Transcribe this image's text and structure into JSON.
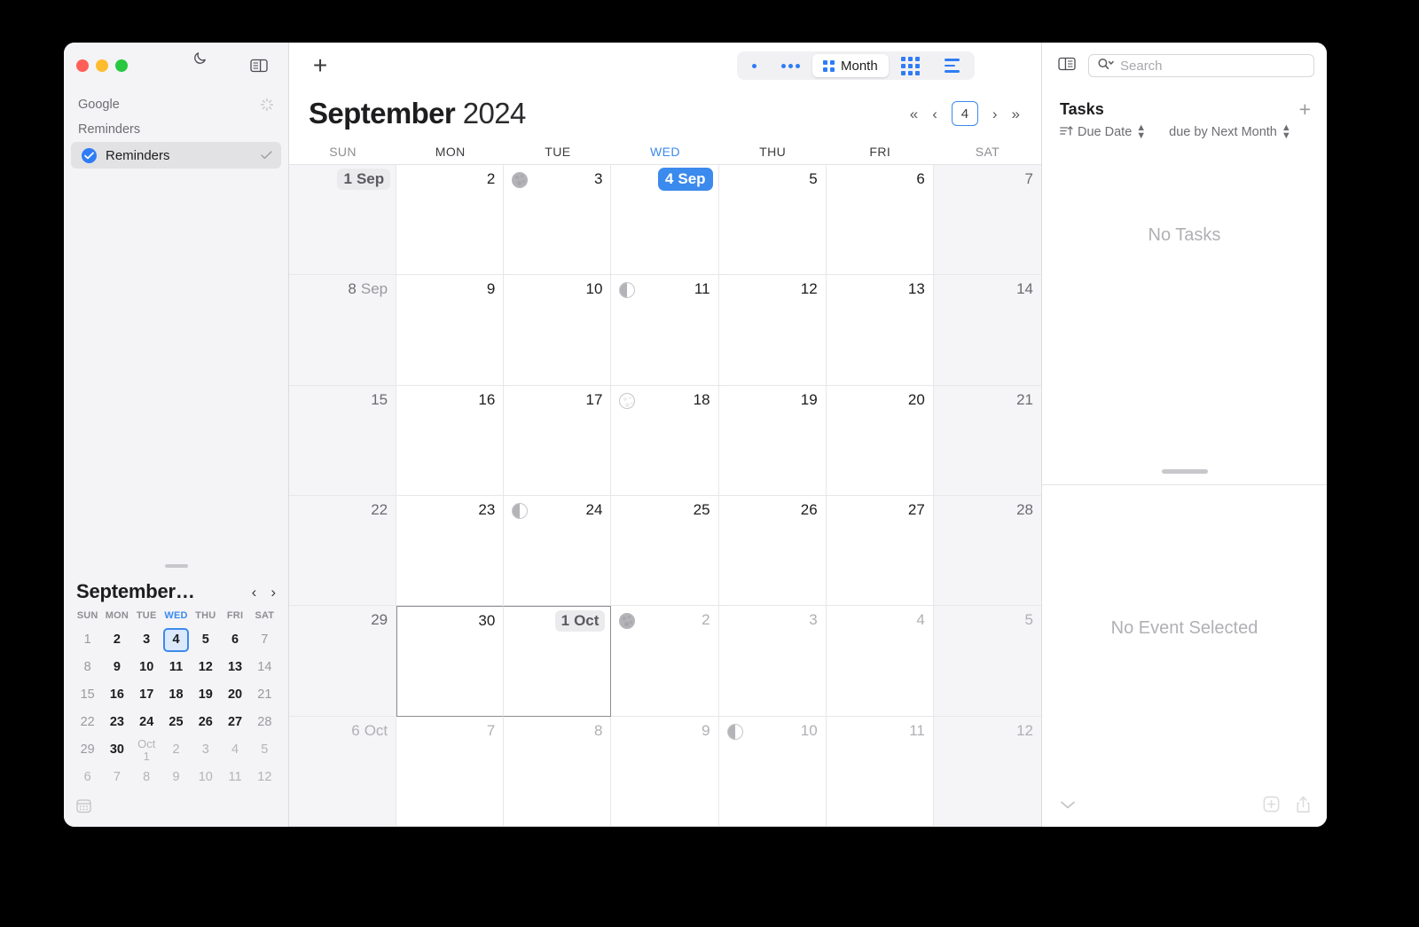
{
  "window": {
    "traffic_lights": [
      "close",
      "minimize",
      "zoom"
    ],
    "accent_blue": "#3b8aed",
    "today_blue": "#2f7cf6"
  },
  "sidebar": {
    "toolbar": {
      "dark_mode_icon": "moon-icon",
      "toggle_sidebar_icon": "sidebar-panel-icon"
    },
    "sections": [
      {
        "label": "Google",
        "status_icon": "sync-spinner-icon"
      },
      {
        "label": "Reminders"
      }
    ],
    "items": [
      {
        "label": "Reminders",
        "checked": true,
        "selected": true,
        "trailing_icon": "checkmark-icon"
      }
    ],
    "mini_calendar": {
      "title": "September…",
      "prev_label": "‹",
      "next_label": "›",
      "dow": [
        "SUN",
        "MON",
        "TUE",
        "WED",
        "THU",
        "FRI",
        "SAT"
      ],
      "highlight_dow": "WED",
      "selected_day": "4",
      "weeks": [
        [
          {
            "t": "1",
            "k": "weekend"
          },
          {
            "t": "2",
            "k": "wd"
          },
          {
            "t": "3",
            "k": "wd"
          },
          {
            "t": "4",
            "k": "sel"
          },
          {
            "t": "5",
            "k": "wd"
          },
          {
            "t": "6",
            "k": "wd"
          },
          {
            "t": "7",
            "k": "weekend"
          }
        ],
        [
          {
            "t": "8",
            "k": "weekend"
          },
          {
            "t": "9",
            "k": "wd"
          },
          {
            "t": "10",
            "k": "wd"
          },
          {
            "t": "11",
            "k": "wd"
          },
          {
            "t": "12",
            "k": "wd"
          },
          {
            "t": "13",
            "k": "wd"
          },
          {
            "t": "14",
            "k": "weekend"
          }
        ],
        [
          {
            "t": "15",
            "k": "weekend"
          },
          {
            "t": "16",
            "k": "wd"
          },
          {
            "t": "17",
            "k": "wd"
          },
          {
            "t": "18",
            "k": "wd"
          },
          {
            "t": "19",
            "k": "wd"
          },
          {
            "t": "20",
            "k": "wd"
          },
          {
            "t": "21",
            "k": "weekend"
          }
        ],
        [
          {
            "t": "22",
            "k": "weekend"
          },
          {
            "t": "23",
            "k": "wd"
          },
          {
            "t": "24",
            "k": "wd"
          },
          {
            "t": "25",
            "k": "wd"
          },
          {
            "t": "26",
            "k": "wd"
          },
          {
            "t": "27",
            "k": "wd"
          },
          {
            "t": "28",
            "k": "weekend"
          }
        ],
        [
          {
            "t": "29",
            "k": "weekend"
          },
          {
            "t": "30",
            "k": "wd"
          },
          {
            "t": "Oct 1",
            "k": "mon1"
          },
          {
            "t": "2",
            "k": "dim"
          },
          {
            "t": "3",
            "k": "dim"
          },
          {
            "t": "4",
            "k": "dim"
          },
          {
            "t": "5",
            "k": "dim"
          }
        ],
        [
          {
            "t": "6",
            "k": "dim"
          },
          {
            "t": "7",
            "k": "dim"
          },
          {
            "t": "8",
            "k": "dim"
          },
          {
            "t": "9",
            "k": "dim"
          },
          {
            "t": "10",
            "k": "dim"
          },
          {
            "t": "11",
            "k": "dim"
          },
          {
            "t": "12",
            "k": "dim"
          }
        ]
      ],
      "footer_icon": "mini-calendar-icon"
    }
  },
  "center": {
    "add_button": "+",
    "view_switcher": {
      "options": [
        {
          "name": "day-view",
          "icon": "single-dot-icon",
          "label": ""
        },
        {
          "name": "week-view",
          "icon": "three-dots-icon",
          "label": ""
        },
        {
          "name": "month-view",
          "icon": "grid-2x2-icon",
          "label": "Month",
          "active": true
        },
        {
          "name": "year-view",
          "icon": "grid-3x3-icon",
          "label": ""
        },
        {
          "name": "list-view",
          "icon": "list-lines-icon",
          "label": ""
        }
      ]
    },
    "title_month": "September",
    "title_year": "2024",
    "nav": {
      "first": "«",
      "prev": "‹",
      "today": "4",
      "next": "›",
      "last": "»"
    },
    "dow": [
      {
        "label": "SUN",
        "kind": "weekend"
      },
      {
        "label": "MON",
        "kind": "weekday"
      },
      {
        "label": "TUE",
        "kind": "weekday"
      },
      {
        "label": "WED",
        "kind": "highlight"
      },
      {
        "label": "THU",
        "kind": "weekday"
      },
      {
        "label": "FRI",
        "kind": "weekday"
      },
      {
        "label": "SAT",
        "kind": "weekend"
      }
    ],
    "weeks": [
      [
        {
          "num": "1",
          "mon": "Sep",
          "style": "pill",
          "weekend": true
        },
        {
          "num": "2"
        },
        {
          "num": "3",
          "moon": "new"
        },
        {
          "num": "4",
          "mon": "Sep",
          "style": "today"
        },
        {
          "num": "5"
        },
        {
          "num": "6"
        },
        {
          "num": "7",
          "weekend": true
        }
      ],
      [
        {
          "num": "8",
          "mon": "Sep",
          "weekend": true
        },
        {
          "num": "9"
        },
        {
          "num": "10"
        },
        {
          "num": "11",
          "moon": "last-q"
        },
        {
          "num": "12"
        },
        {
          "num": "13"
        },
        {
          "num": "14",
          "weekend": true
        }
      ],
      [
        {
          "num": "15",
          "weekend": true
        },
        {
          "num": "16"
        },
        {
          "num": "17"
        },
        {
          "num": "18",
          "moon": "full"
        },
        {
          "num": "19"
        },
        {
          "num": "20"
        },
        {
          "num": "21",
          "weekend": true
        }
      ],
      [
        {
          "num": "22",
          "weekend": true
        },
        {
          "num": "23"
        },
        {
          "num": "24",
          "moon": "last-q"
        },
        {
          "num": "25"
        },
        {
          "num": "26"
        },
        {
          "num": "27"
        },
        {
          "num": "28",
          "weekend": true
        }
      ],
      [
        {
          "num": "29",
          "weekend": true
        },
        {
          "num": "30",
          "box": "left-top-bottom"
        },
        {
          "num": "1",
          "mon": "Oct",
          "style": "pill",
          "box": "top-bottom-right"
        },
        {
          "num": "2",
          "dim": true,
          "moon": "new"
        },
        {
          "num": "3",
          "dim": true
        },
        {
          "num": "4",
          "dim": true
        },
        {
          "num": "5",
          "dim": true,
          "weekend": true
        }
      ],
      [
        {
          "num": "6",
          "mon": "Oct",
          "dim": true,
          "weekend": true
        },
        {
          "num": "7",
          "dim": true
        },
        {
          "num": "8",
          "dim": true
        },
        {
          "num": "9",
          "dim": true
        },
        {
          "num": "10",
          "dim": true,
          "moon": "last-q"
        },
        {
          "num": "11",
          "dim": true
        },
        {
          "num": "12",
          "dim": true,
          "weekend": true
        }
      ]
    ]
  },
  "inspector": {
    "toggle_icon": "inspector-panel-icon",
    "search": {
      "placeholder": "Search",
      "value": "",
      "icon": "search-magnifier-chevron-icon"
    },
    "tasks": {
      "title": "Tasks",
      "add_label": "+",
      "sort_label": "Due Date",
      "sort_icon": "sort-ascending-icon",
      "filter_label": "due by Next Month",
      "empty_message": "No Tasks"
    },
    "event": {
      "empty_message": "No Event Selected"
    },
    "footer": {
      "collapse_icon": "chevron-down-icon",
      "add_to_icon": "add-to-box-icon",
      "share_icon": "share-icon"
    }
  }
}
